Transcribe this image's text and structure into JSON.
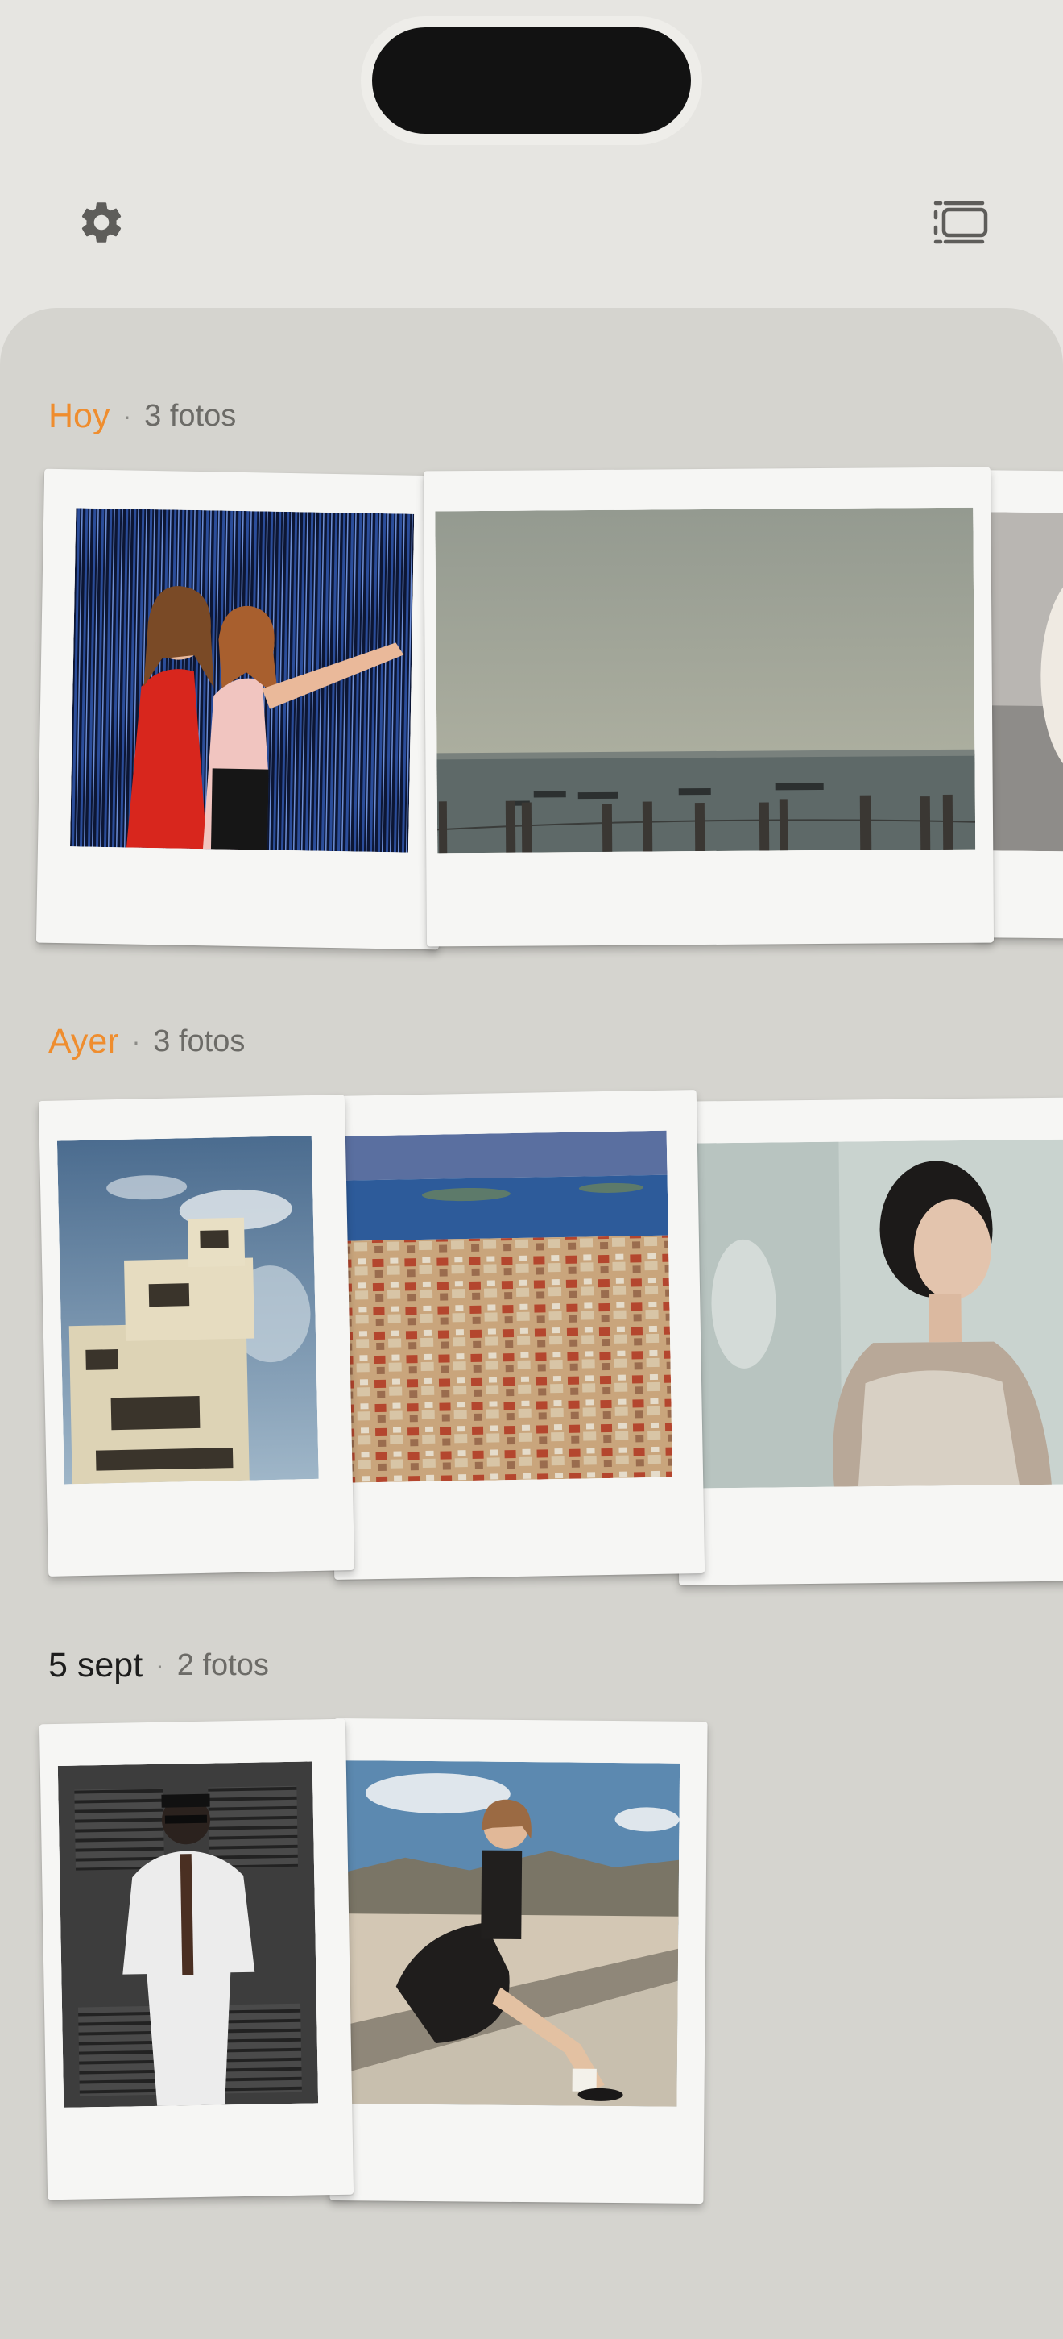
{
  "toolbar": {
    "settings_icon": "gear-icon",
    "layout_icon": "stack-view-icon"
  },
  "sections": [
    {
      "title": "Hoy",
      "separator": "·",
      "count": "3 fotos",
      "accent": "#ef8d2e",
      "photos": [
        "two women posing at party",
        "sea with boats and pier posts",
        "white cat (partially visible)"
      ]
    },
    {
      "title": "Ayer",
      "separator": "·",
      "count": "3 fotos",
      "accent": "#ef8d2e",
      "photos": [
        "modern white building against sky",
        "coastal city rooftops",
        "woman leaning on wall in sunlight"
      ]
    },
    {
      "title": "5 sept",
      "separator": "·",
      "count": "2 fotos",
      "accent": "#1d1d1d",
      "photos": [
        "man in white suit in black and white",
        "woman sitting on rooftop ledge"
      ]
    }
  ],
  "colors": {
    "background": "#e6e5e1",
    "sheet": "#d5d4cf",
    "accent": "#ef8d2e",
    "polaroid": "#f6f6f4"
  }
}
